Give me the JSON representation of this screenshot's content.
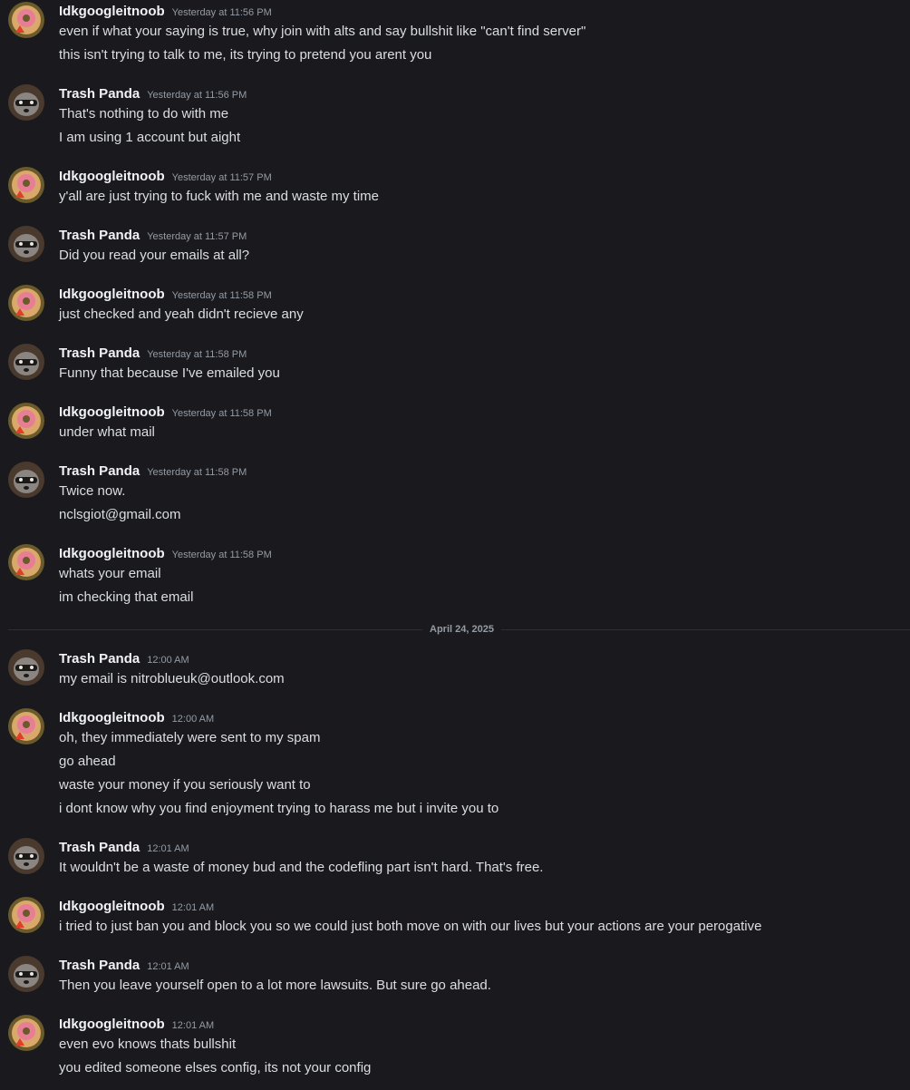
{
  "users": {
    "idk": "Idkgoogleitnoob",
    "panda": "Trash Panda"
  },
  "date_divider": "April 24, 2025",
  "messages": [
    {
      "author": "Idkgoogleitnoob",
      "time": "Yesterday at 11:56 PM",
      "lines": [
        "even if what your saying is true, why join with alts and say bullshit like \"can't find server\"",
        "this isn't trying to talk to me, its trying to pretend you arent you"
      ]
    },
    {
      "author": "Trash Panda",
      "time": "Yesterday at 11:56 PM",
      "lines": [
        "That's nothing to do with me",
        "I am using 1 account but aight"
      ]
    },
    {
      "author": "Idkgoogleitnoob",
      "time": "Yesterday at 11:57 PM",
      "lines": [
        "y'all are just trying to fuck with me and waste my time"
      ]
    },
    {
      "author": "Trash Panda",
      "time": "Yesterday at 11:57 PM",
      "lines": [
        "Did you read your emails at all?"
      ]
    },
    {
      "author": "Idkgoogleitnoob",
      "time": "Yesterday at 11:58 PM",
      "lines": [
        "just checked and yeah didn't recieve any"
      ]
    },
    {
      "author": "Trash Panda",
      "time": "Yesterday at 11:58 PM",
      "lines": [
        "Funny that because I've emailed you"
      ]
    },
    {
      "author": "Idkgoogleitnoob",
      "time": "Yesterday at 11:58 PM",
      "lines": [
        "under what mail"
      ]
    },
    {
      "author": "Trash Panda",
      "time": "Yesterday at 11:58 PM",
      "lines": [
        "Twice now.",
        "nclsgiot@gmail.com"
      ]
    },
    {
      "author": "Idkgoogleitnoob",
      "time": "Yesterday at 11:58 PM",
      "lines": [
        "whats your email",
        "im checking that email"
      ]
    },
    {
      "author": "Trash Panda",
      "time": "12:00 AM",
      "lines": [
        "my email is nitroblueuk@outlook.com"
      ]
    },
    {
      "author": "Idkgoogleitnoob",
      "time": "12:00 AM",
      "lines": [
        "oh, they immediately were sent to my spam",
        "go ahead",
        "waste your money if you seriously want to",
        "i dont know why you find enjoyment trying to harass me but i invite you to"
      ]
    },
    {
      "author": "Trash Panda",
      "time": "12:01 AM",
      "lines": [
        "It wouldn't be a waste of money bud and the codefling part isn't hard. That's free."
      ]
    },
    {
      "author": "Idkgoogleitnoob",
      "time": "12:01 AM",
      "lines": [
        "i tried to just ban you and block you so we could just both move on with our lives but your actions are your perogative"
      ]
    },
    {
      "author": "Trash Panda",
      "time": "12:01 AM",
      "lines": [
        "Then you leave yourself open to a lot more lawsuits. But sure go ahead."
      ]
    },
    {
      "author": "Idkgoogleitnoob",
      "time": "12:01 AM",
      "lines": [
        "even evo knows thats bullshit",
        "you edited someone elses config, its not your config"
      ]
    }
  ],
  "colors": {
    "background": "#1a1a1e",
    "author": "#f2f3f5",
    "text": "#dbdee1",
    "muted": "#949ba4"
  }
}
